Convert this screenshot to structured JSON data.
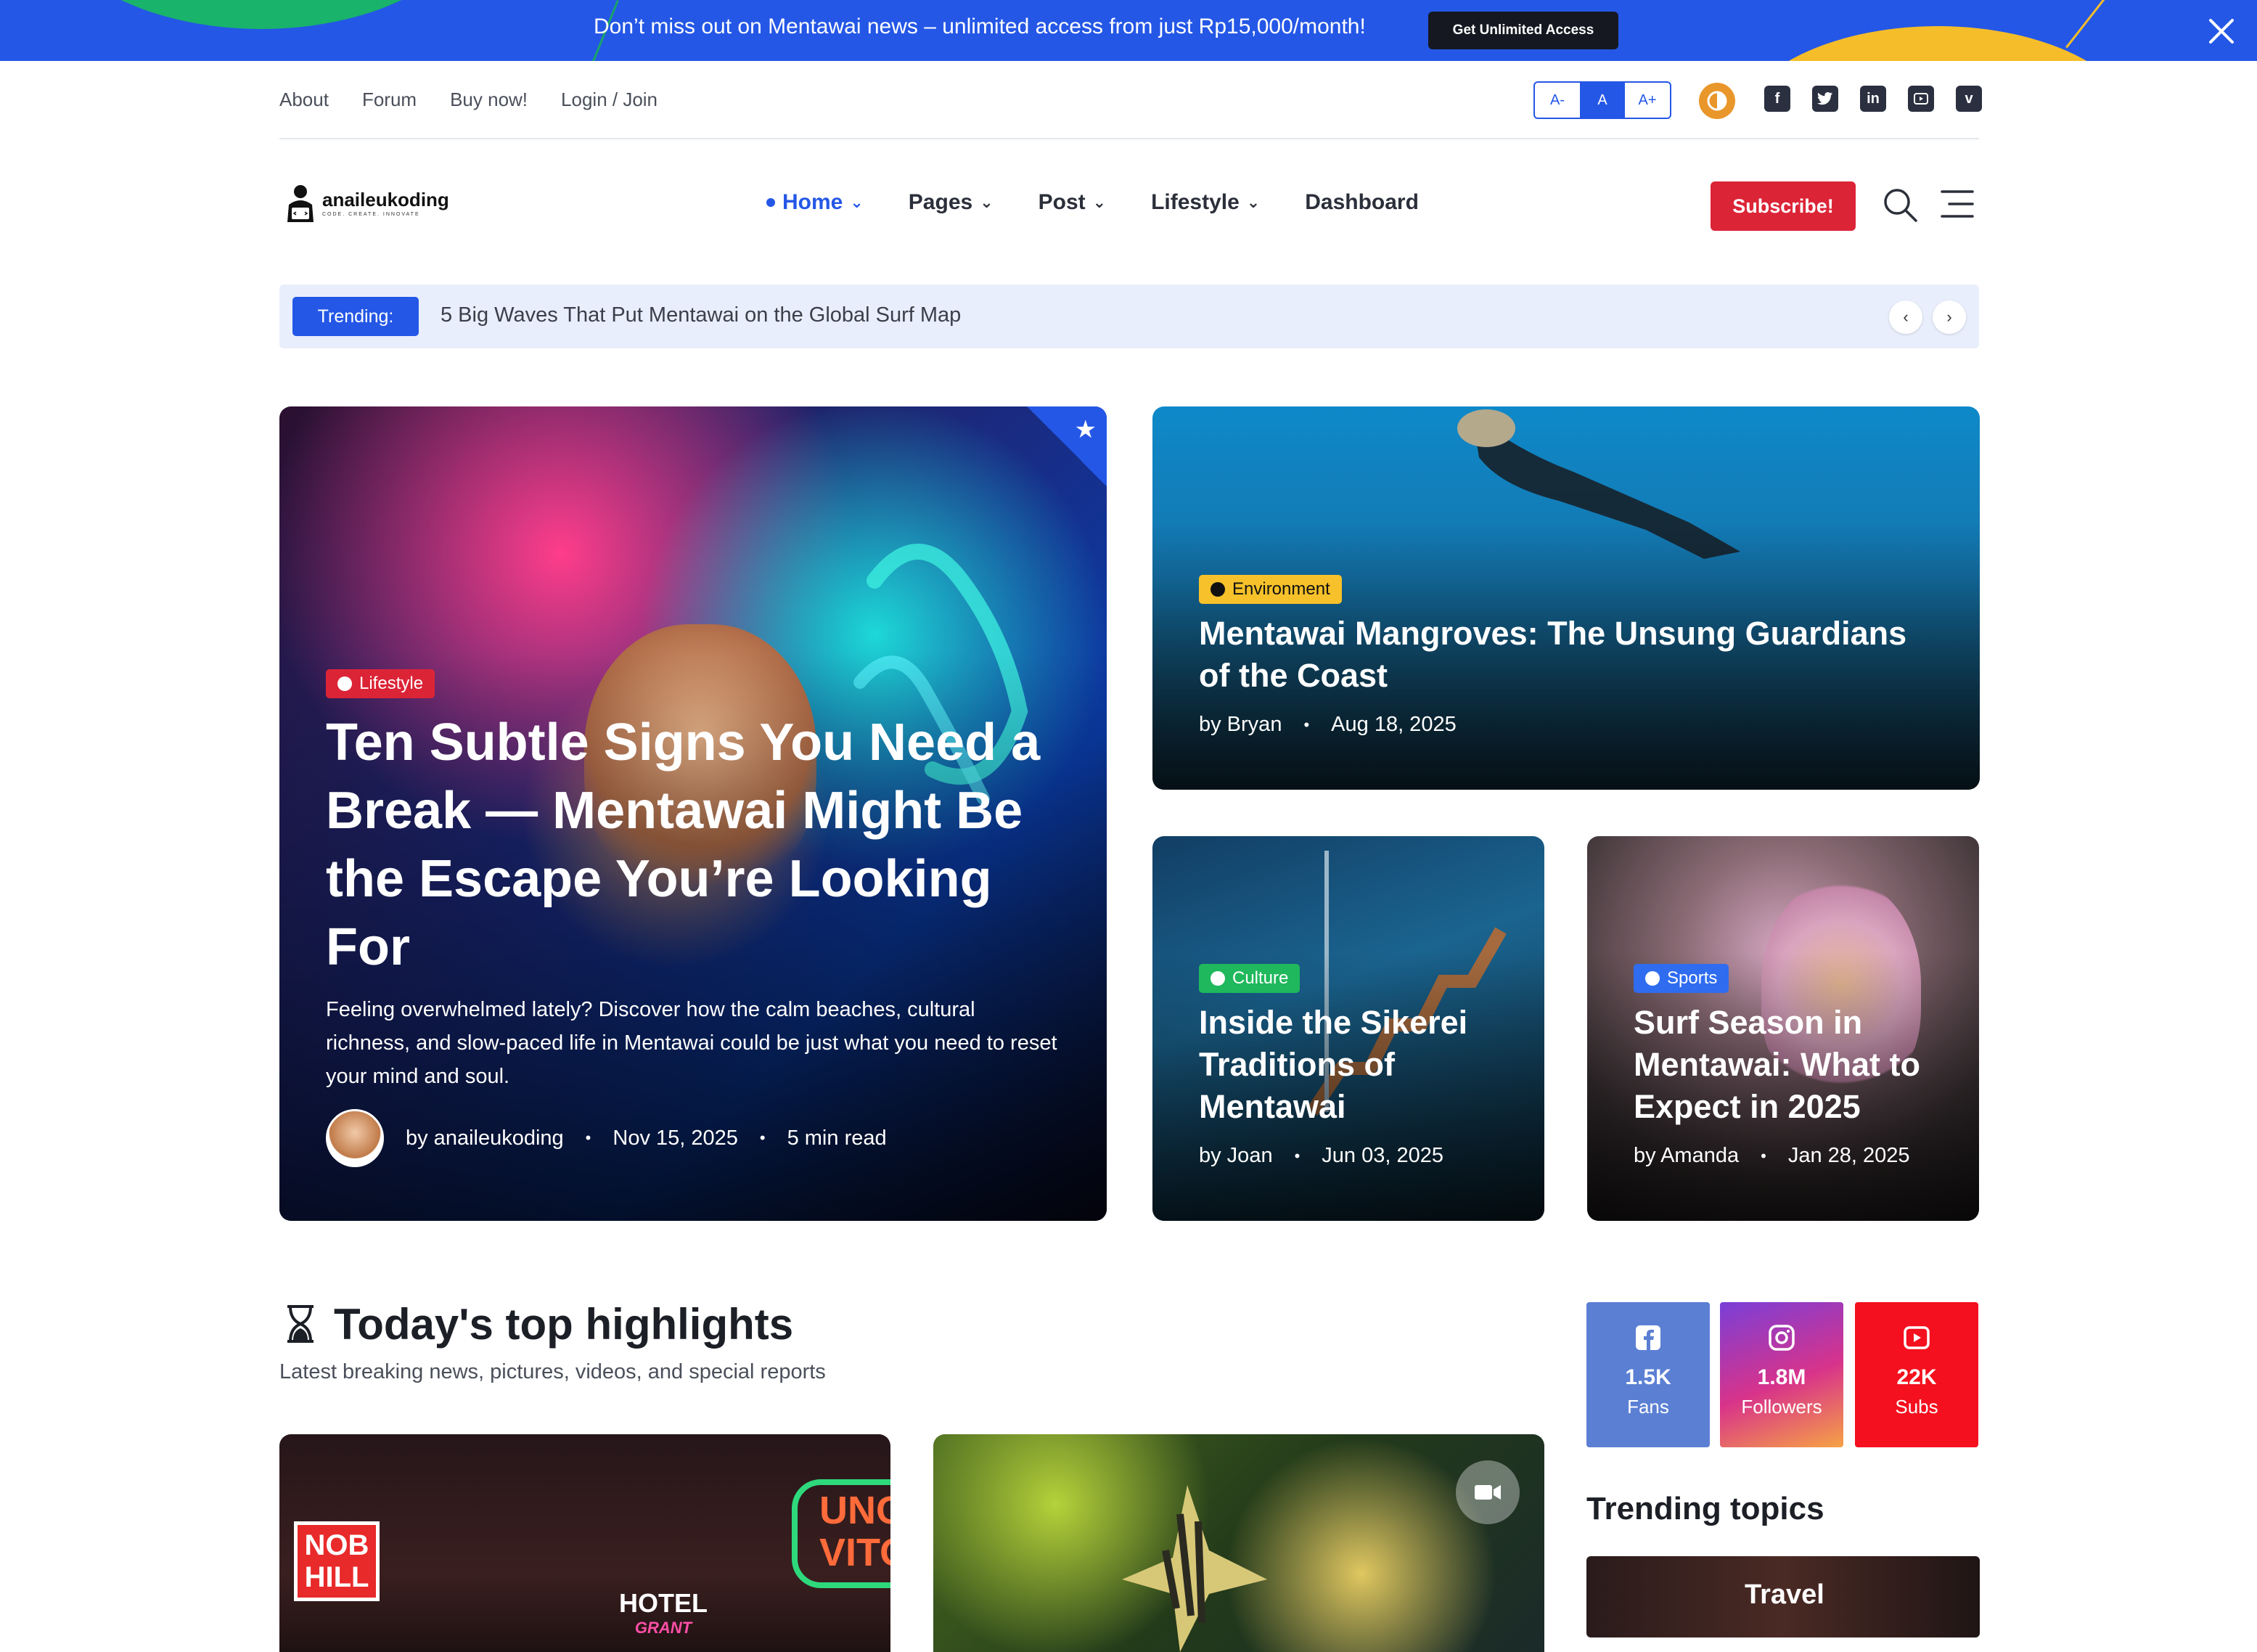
{
  "promo": {
    "text": "Don’t miss out on Mentawai news – unlimited access from just Rp15,000/month!",
    "button": "Get Unlimited Access"
  },
  "topbar": {
    "links": [
      "About",
      "Forum",
      "Buy now!",
      "Login / Join"
    ],
    "font_sizes": [
      "A-",
      "A",
      "A+"
    ],
    "social_icons": [
      "facebook-icon",
      "twitter-icon",
      "linkedin-icon",
      "youtube-icon",
      "vimeo-icon"
    ]
  },
  "brand": {
    "name": "anaileukoding",
    "tagline": "CODE. CREATE. INNOVATE"
  },
  "nav": {
    "items": [
      "Home",
      "Pages",
      "Post",
      "Lifestyle",
      "Dashboard"
    ],
    "subscribe": "Subscribe!"
  },
  "trending": {
    "label": "Trending:",
    "headline": "5 Big Waves That Put Mentawai on the Global Surf Map"
  },
  "featured": {
    "main": {
      "category": "Lifestyle",
      "title": "Ten Subtle Signs You Need a Break — Mentawai Might Be the Escape You’re Looking For",
      "excerpt": "Feeling overwhelmed lately? Discover how the calm beaches, cultural richness, and slow-paced life in Mentawai could be just what you need to reset your mind and soul.",
      "author": "by anaileukoding",
      "date": "Nov 15, 2025",
      "read_time": "5 min read"
    },
    "env": {
      "category": "Environment",
      "title": "Mentawai Mangroves: The Unsung Guardians of the Coast",
      "author": "by Bryan",
      "date": "Aug 18, 2025"
    },
    "culture": {
      "category": "Culture",
      "title": "Inside the Sikerei Traditions of Mentawai",
      "author": "by Joan",
      "date": "Jun 03, 2025"
    },
    "sports": {
      "category": "Sports",
      "title": "Surf Season in Mentawai: What to Expect in 2025",
      "author": "by Amanda",
      "date": "Jan 28, 2025"
    }
  },
  "highlights": {
    "title": "Today's top highlights",
    "subtitle": "Latest breaking news, pictures, videos, and special reports",
    "signs": {
      "nob_hill": "NOB HILL",
      "hotel": "HOTEL",
      "hotel_sub": "GRANT",
      "neon": "UNC VITO"
    }
  },
  "social_stats": [
    {
      "count": "1.5K",
      "label": "Fans"
    },
    {
      "count": "1.8M",
      "label": "Followers"
    },
    {
      "count": "22K",
      "label": "Subs"
    }
  ],
  "trending_topics": {
    "title": "Trending topics",
    "first": "Travel"
  },
  "colors": {
    "primary": "#2457e6",
    "lifestyle": "#dc2437",
    "environment": "#f6c12a",
    "culture": "#1fb85c",
    "sports": "#2f6cf0"
  }
}
